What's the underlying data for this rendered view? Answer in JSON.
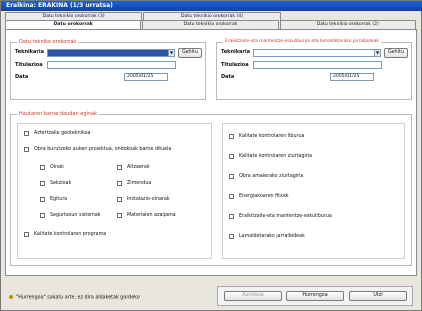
{
  "window": {
    "title": "Eralkina: ERAKINA     (1/3 urratsa)"
  },
  "tabs_top": [
    "Datu teknikio orokorrak (3)",
    "Datu teknikio orokorrak (4)"
  ],
  "tabs_main": [
    "Datu orokorrak",
    "Datu teknikio orokorrak",
    "Datu teknikio orokorrak (2)"
  ],
  "left_group": {
    "title": "Datu tekniko orokorrak",
    "label_teknikaria": "Teknikaria",
    "label_titulazioa": "Titulazioa",
    "label_data": "Data",
    "date": "2005/01/25",
    "gehitu": "Gehitu"
  },
  "right_group": {
    "title": "Eraikitzaile-eta mantentze-eskuliburua eta lamaldetarako jarraibideak",
    "label_teknikaria": "Teknikaria",
    "label_titulazioa": "Titulazioa",
    "label_data": "Data",
    "date": "2005/01/25",
    "gehitu": "Gehitu"
  },
  "checks_group": {
    "title": "Hautaren barne daudan eginak",
    "left": {
      "c1": "Aztertzaile geoteknikoa",
      "c2": "Obra burutzeko auken proiektua, ondokoak barne dituela",
      "sub_left": [
        "Oinak",
        "Sekzioak",
        "Egitura",
        "Segurtasun sistemak"
      ],
      "sub_right": [
        "Altzaerak",
        "Zimendua",
        "Instalazio-oinarak",
        "Materialen azalpena"
      ],
      "c3": "Kalitate kontrolaren programa"
    },
    "right": [
      "Kalitate kontrolaren liburua",
      "Kalitate kontrolaren ziurtagiria",
      "Obra amaierako ziurtagiria",
      "Energiakoaren fitxak",
      "Eraikitzaile-eta mantentze-eskuliburua",
      "Lamaldetarako jarraibideak"
    ]
  },
  "footer": {
    "message": "\"Hurrengoa\" sakatu arte, ez dira aldaketak gordeko",
    "buttons": {
      "aurrekoa": "Aurrekoa",
      "hurrengoa": "Hurrengoa",
      "utzi": "Utzi"
    }
  }
}
